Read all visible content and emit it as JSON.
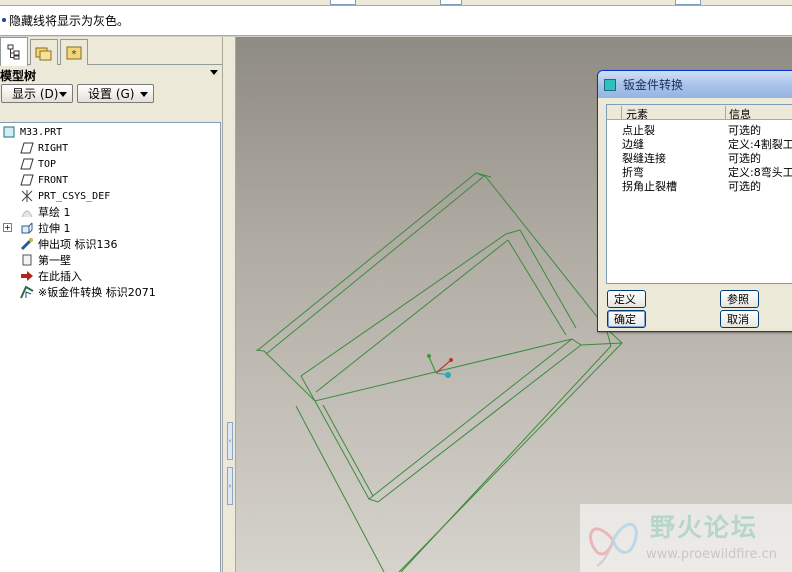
{
  "message": "隐藏线将显示为灰色。",
  "model_tree": {
    "title": "模型树",
    "show_button": "显示 (D)",
    "settings_button": "设置 (G)",
    "items": [
      {
        "label": "M33.PRT",
        "icon": "part-icon"
      },
      {
        "label": "RIGHT",
        "icon": "datum-plane-icon"
      },
      {
        "label": "TOP",
        "icon": "datum-plane-icon"
      },
      {
        "label": "FRONT",
        "icon": "datum-plane-icon"
      },
      {
        "label": "PRT_CSYS_DEF",
        "icon": "csys-icon"
      },
      {
        "label": "草绘 1",
        "icon": "sketch-icon"
      },
      {
        "label": "拉伸 1",
        "icon": "extrude-icon"
      },
      {
        "label": "伸出项 标识136",
        "icon": "protrusion-icon"
      },
      {
        "label": "第一壁",
        "icon": "wall-icon"
      },
      {
        "label": "在此插入",
        "icon": "insert-here-arrow-icon"
      },
      {
        "label": "※钣金件转换 标识2071",
        "icon": "sheetmetal-convert-icon"
      }
    ]
  },
  "dialog": {
    "title": "钣金件转换",
    "columns": [
      "元素",
      "信息"
    ],
    "rows": [
      {
        "element": "点止裂",
        "info": "可选的"
      },
      {
        "element": "边缝",
        "info": "定义:4割裂工"
      },
      {
        "element": "裂缝连接",
        "info": "可选的"
      },
      {
        "element": "折弯",
        "info": "定义:8弯头工"
      },
      {
        "element": "拐角止裂槽",
        "info": "可选的"
      }
    ],
    "buttons": {
      "define": "定义",
      "reference": "参照",
      "ok": "确定",
      "cancel": "取消"
    }
  },
  "watermark": {
    "title": "野火论坛",
    "url": "www.proewildfire.cn"
  },
  "colors": {
    "model_edges": "#3c8a3c",
    "selection_blue": "#316ac5"
  }
}
